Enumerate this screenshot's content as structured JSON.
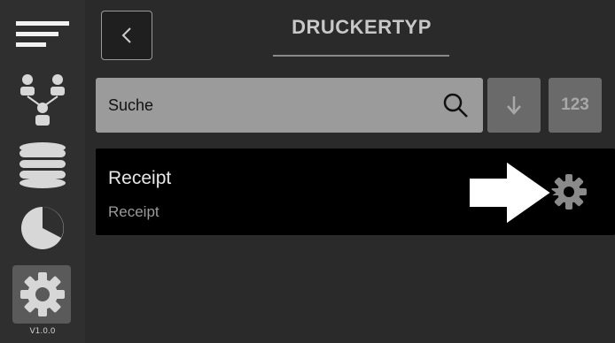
{
  "sidebar": {
    "items": [
      {
        "icon": "menu-icon"
      },
      {
        "icon": "users-icon"
      },
      {
        "icon": "database-icon"
      },
      {
        "icon": "pie-chart-icon"
      },
      {
        "icon": "gear-icon"
      }
    ],
    "active_item": "settings",
    "version": "V1.0.0"
  },
  "header": {
    "back_label": "<",
    "title": "DRUCKERTYP"
  },
  "search": {
    "placeholder": "Suche",
    "value": ""
  },
  "toolbar": {
    "sort_icon": "arrow-down-icon",
    "numeric_label": "123"
  },
  "list": {
    "items": [
      {
        "title": "Receipt",
        "subtitle": "Receipt"
      }
    ]
  },
  "colors": {
    "sidebar_bg": "#2f2f2f",
    "main_bg": "#2a2a2a",
    "search_bg": "#9b9b9b",
    "button_bg": "#6a6a6a",
    "item_bg": "#000000"
  }
}
